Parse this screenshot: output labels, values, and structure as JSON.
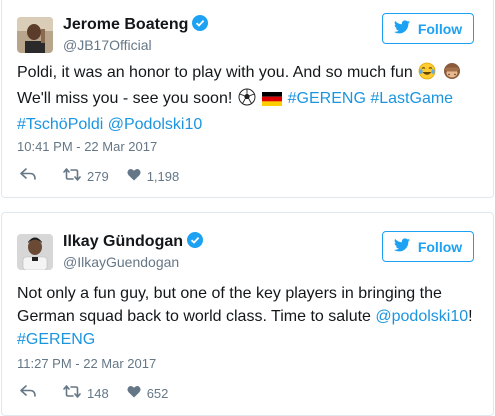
{
  "tweets": [
    {
      "name": "Jerome Boateng",
      "handle": "@JB17Official",
      "follow_label": "Follow",
      "text": {
        "line1": "Poldi, it was an honor to play with you. And so much fun",
        "line2a": "We'll miss you - see you soon!",
        "hashtag1": "#GERENG",
        "hashtag2": "#LastGame",
        "hashtag3": "#TschöPoldi",
        "mention": "@Podolski10"
      },
      "timestamp": "10:41 PM - 22 Mar 2017",
      "retweets": "279",
      "likes": "1,198",
      "emojis": [
        "tears-of-joy-emoji",
        "see-no-evil-monkey-emoji",
        "soccer-ball-emoji",
        "germany-flag-emoji"
      ]
    },
    {
      "name": "Ilkay Gündogan",
      "handle": "@IlkayGuendogan",
      "follow_label": "Follow",
      "text": {
        "line1": "Not only a fun guy, but one of the key players in bringing the",
        "line2a": "German squad back to world class. Time to salute",
        "mention": "@podolski10",
        "line2b": "!",
        "hashtag1": "#GERENG"
      },
      "timestamp": "11:27 PM - 22 Mar 2017",
      "retweets": "148",
      "likes": "652"
    }
  ],
  "colors": {
    "link": "#1b95e0",
    "follow": "#1da1f2",
    "meta": "#657786",
    "border": "#e1e8ed"
  }
}
